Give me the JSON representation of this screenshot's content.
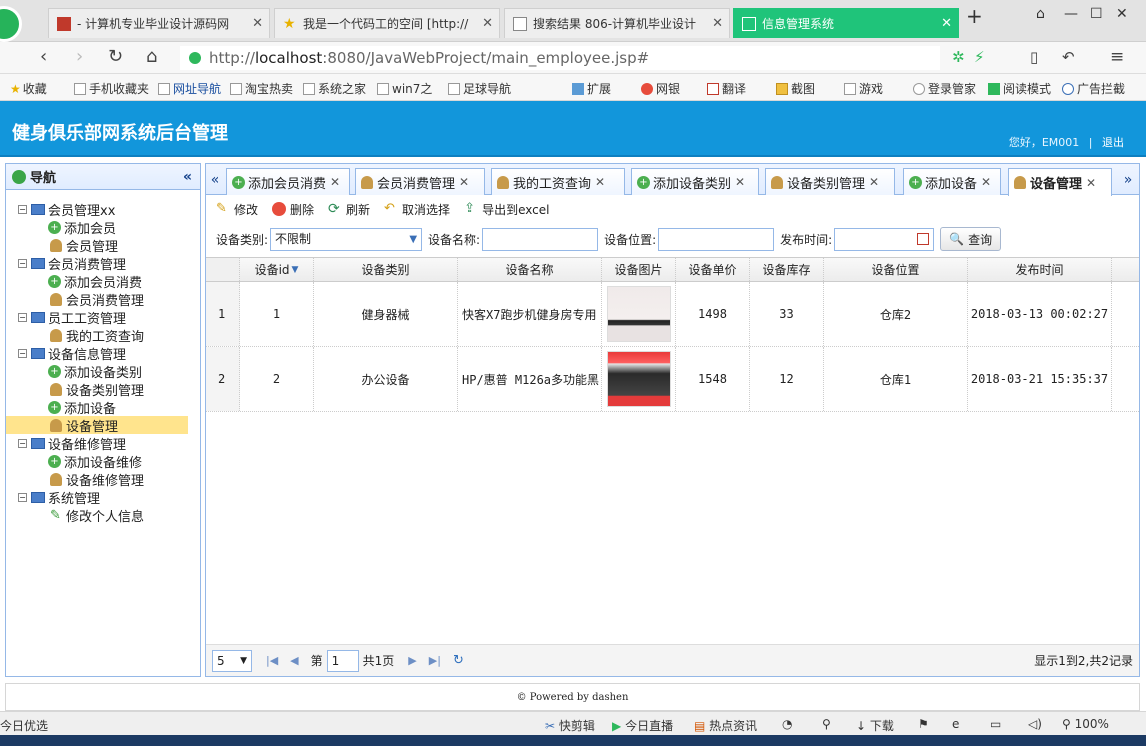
{
  "browser": {
    "tabs": [
      {
        "title": "- 计算机专业毕业设计源码网"
      },
      {
        "title": "我是一个代码工的空间 [http://"
      },
      {
        "title": "搜索结果 806-计算机毕业设计"
      },
      {
        "title": "信息管理系统"
      }
    ],
    "url_prefix": "http://",
    "url_host": "localhost",
    "url_rest": ":8080/JavaWebProject/main_employee.jsp#",
    "bookmarks": [
      "收藏",
      "手机收藏夹",
      "网址导航",
      "淘宝热卖",
      "系统之家",
      "win7之",
      "足球导航",
      "扩展",
      "网银",
      "翻译",
      "截图",
      "游戏",
      "登录管家",
      "阅读模式",
      "广告拦截"
    ]
  },
  "header": {
    "title": "健身俱乐部网系统后台管理",
    "greeting": "您好，EM001",
    "logout": "退出"
  },
  "sidebar": {
    "title": "导航",
    "groups": [
      {
        "label": "会员管理xx",
        "items": [
          "添加会员",
          "会员管理"
        ]
      },
      {
        "label": "会员消费管理",
        "items": [
          "添加会员消费",
          "会员消费管理"
        ]
      },
      {
        "label": "员工工资管理",
        "items": [
          "我的工资查询"
        ]
      },
      {
        "label": "设备信息管理",
        "items": [
          "添加设备类别",
          "设备类别管理",
          "添加设备",
          "设备管理"
        ]
      },
      {
        "label": "设备维修管理",
        "items": [
          "添加设备维修",
          "设备维修管理"
        ]
      },
      {
        "label": "系统管理",
        "items": [
          "修改个人信息"
        ]
      }
    ]
  },
  "content_tabs": [
    "添加会员消费",
    "会员消费管理",
    "我的工资查询",
    "添加设备类别",
    "设备类别管理",
    "添加设备",
    "设备管理"
  ],
  "toolbar": {
    "edit": "修改",
    "delete": "删除",
    "refresh": "刷新",
    "cancel_select": "取消选择",
    "export": "导出到excel"
  },
  "filters": {
    "category_label": "设备类别:",
    "category_value": "不限制",
    "name_label": "设备名称:",
    "location_label": "设备位置:",
    "time_label": "发布时间:",
    "query_button": "查询"
  },
  "grid": {
    "headers": [
      "设备id",
      "设备类别",
      "设备名称",
      "设备图片",
      "设备单价",
      "设备库存",
      "设备位置",
      "发布时间"
    ],
    "rows": [
      {
        "rownum": "1",
        "id": "1",
        "category": "健身器械",
        "name": "快客X7跑步机健身房专用",
        "price": "1498",
        "stock": "33",
        "location": "仓库2",
        "time": "2018-03-13 00:02:27"
      },
      {
        "rownum": "2",
        "id": "2",
        "category": "办公设备",
        "name": "HP/惠普 M126a多功能黑",
        "price": "1548",
        "stock": "12",
        "location": "仓库1",
        "time": "2018-03-21 15:35:37"
      }
    ]
  },
  "pager": {
    "page_size": "5",
    "page_prefix": "第",
    "page_value": "1",
    "page_total": "共1页",
    "summary": "显示1到2,共2记录"
  },
  "footer": "© Powered by dashen",
  "statusbar": {
    "left": "今日优选",
    "items": [
      "快剪辑",
      "今日直播",
      "热点资讯",
      "下载",
      "100%"
    ]
  }
}
